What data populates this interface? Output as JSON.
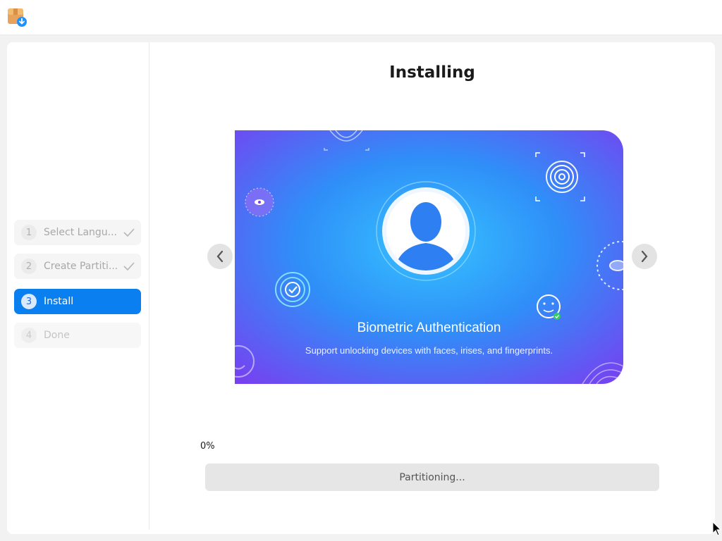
{
  "sidebar": {
    "steps": [
      {
        "number": "1",
        "label": "Select Langu...",
        "state": "completed"
      },
      {
        "number": "2",
        "label": "Create Partiti...",
        "state": "completed"
      },
      {
        "number": "3",
        "label": "Install",
        "state": "active"
      },
      {
        "number": "4",
        "label": "Done",
        "state": "pending"
      }
    ]
  },
  "main": {
    "title": "Installing",
    "slide": {
      "title": "Biometric Authentication",
      "subtitle": "Support unlocking devices with faces, irises, and fingerprints."
    },
    "progress": {
      "percent_label": "0%",
      "value": 0,
      "status": "Partitioning..."
    }
  },
  "colors": {
    "accent": "#0a7ff0",
    "slide_gradient_center": "#2fb4ff",
    "slide_gradient_edge": "#7a3cf0"
  },
  "icons": [
    "installer-app-icon",
    "check-icon",
    "chevron-left-icon",
    "chevron-right-icon",
    "fingerprint-icon",
    "eye-icon",
    "face-id-icon",
    "user-avatar-icon"
  ]
}
